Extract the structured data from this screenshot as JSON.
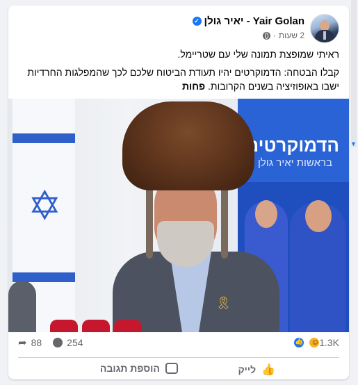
{
  "post": {
    "author_name": "Yair Golan - יאיר גולן",
    "verified_icon": "verified-badge-icon",
    "time": "2 שעות",
    "visibility_icon": "globe-icon",
    "text_line_1": "ראיתי שמופצת תמונה שלי עם שטריימל.",
    "text_line_2": "קבלו הבטחה: הדמוקרטים יהיו תעודת הביטוח שלכם לכך שהמפלגות החרדיות ישבו באופוזיציה בשנים הקרובות.",
    "see_more": "פחות"
  },
  "photo": {
    "panel_title": "הדמוקרטים",
    "panel_subtitle": "בראשות יאיר גולן"
  },
  "stats": {
    "reactions_count": "1.3K",
    "reaction_icons": [
      "like-icon",
      "haha-icon"
    ],
    "comments_count": "254",
    "shares_count": "88"
  },
  "actions": {
    "like_label": "לייק",
    "comment_label": "הוספת תגובה"
  },
  "colors": {
    "accent": "#1877f2",
    "muted": "#65676b",
    "background": "#f0f2f5"
  }
}
